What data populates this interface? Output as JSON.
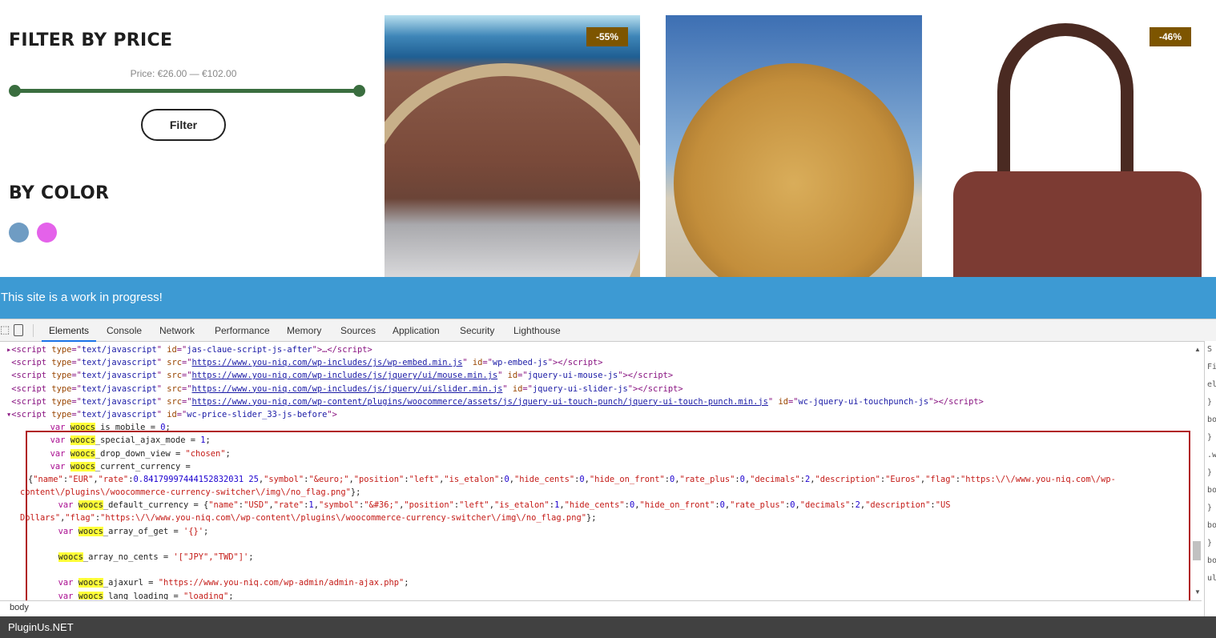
{
  "sidebar": {
    "filter_title": "FILTER BY PRICE",
    "price_label": "Price: €26.00 — €102.00",
    "price_min": 26,
    "price_max": 102,
    "filter_button": "Filter",
    "color_title": "BY COLOR",
    "swatches": [
      "#6f9cc3",
      "#e462ea"
    ]
  },
  "products": [
    {
      "badge": "-55%"
    },
    {
      "badge": ""
    },
    {
      "badge": "-46%"
    }
  ],
  "banner": "This site is a work in progress!",
  "devtools": {
    "tabs": [
      "Elements",
      "Console",
      "Network",
      "Performance",
      "Memory",
      "Sources",
      "Application",
      "Security",
      "Lighthouse"
    ],
    "active_tab": "Elements",
    "code_lines": [
      [
        [
          "tg",
          "▸<script "
        ],
        [
          "an",
          "type"
        ],
        [
          "tg",
          "=\""
        ],
        [
          "av",
          "text/javascript"
        ],
        [
          "tg",
          "\" "
        ],
        [
          "an",
          "id"
        ],
        [
          "tg",
          "=\""
        ],
        [
          "av",
          "jas-claue-script-js-after"
        ],
        [
          "tg",
          "\">…</script>"
        ]
      ],
      [
        [
          "tg",
          " <script "
        ],
        [
          "an",
          "type"
        ],
        [
          "tg",
          "=\""
        ],
        [
          "av",
          "text/javascript"
        ],
        [
          "tg",
          "\" "
        ],
        [
          "an",
          "src"
        ],
        [
          "tg",
          "=\""
        ],
        [
          "lk",
          "https://www.you-niq.com/wp-includes/js/wp-embed.min.js"
        ],
        [
          "tg",
          "\" "
        ],
        [
          "an",
          "id"
        ],
        [
          "tg",
          "=\""
        ],
        [
          "av",
          "wp-embed-js"
        ],
        [
          "tg",
          "\"></script>"
        ]
      ],
      [
        [
          "tg",
          " <script "
        ],
        [
          "an",
          "type"
        ],
        [
          "tg",
          "=\""
        ],
        [
          "av",
          "text/javascript"
        ],
        [
          "tg",
          "\" "
        ],
        [
          "an",
          "src"
        ],
        [
          "tg",
          "=\""
        ],
        [
          "lk",
          "https://www.you-niq.com/wp-includes/js/jquery/ui/mouse.min.js"
        ],
        [
          "tg",
          "\" "
        ],
        [
          "an",
          "id"
        ],
        [
          "tg",
          "=\""
        ],
        [
          "av",
          "jquery-ui-mouse-js"
        ],
        [
          "tg",
          "\"></script>"
        ]
      ],
      [
        [
          "tg",
          " <script "
        ],
        [
          "an",
          "type"
        ],
        [
          "tg",
          "=\""
        ],
        [
          "av",
          "text/javascript"
        ],
        [
          "tg",
          "\" "
        ],
        [
          "an",
          "src"
        ],
        [
          "tg",
          "=\""
        ],
        [
          "lk",
          "https://www.you-niq.com/wp-includes/js/jquery/ui/slider.min.js"
        ],
        [
          "tg",
          "\" "
        ],
        [
          "an",
          "id"
        ],
        [
          "tg",
          "=\""
        ],
        [
          "av",
          "jquery-ui-slider-js"
        ],
        [
          "tg",
          "\"></script>"
        ]
      ],
      [
        [
          "tg",
          " <script "
        ],
        [
          "an",
          "type"
        ],
        [
          "tg",
          "=\""
        ],
        [
          "av",
          "text/javascript"
        ],
        [
          "tg",
          "\" "
        ],
        [
          "an",
          "src"
        ],
        [
          "tg",
          "=\""
        ],
        [
          "lk",
          "https://www.you-niq.com/wp-content/plugins/woocommerce/assets/js/jquery-ui-touch-punch/jquery-ui-touch-punch.min.js"
        ],
        [
          "tg",
          "\" "
        ],
        [
          "an",
          "id"
        ],
        [
          "tg",
          "=\""
        ],
        [
          "av",
          "wc-jquery-ui-touchpunch-js"
        ],
        [
          "tg",
          "\"></script>"
        ]
      ],
      [
        [
          "tg",
          "▾<script "
        ],
        [
          "an",
          "type"
        ],
        [
          "tg",
          "=\""
        ],
        [
          "av",
          "text/javascript"
        ],
        [
          "tg",
          "\" "
        ],
        [
          "an",
          "id"
        ],
        [
          "tg",
          "=\""
        ],
        [
          "av",
          "wc-price-slider_33-js-before"
        ],
        [
          "tg",
          "\">"
        ]
      ],
      [
        [
          "",
          "          "
        ],
        [
          "kw",
          "var "
        ],
        [
          "hl",
          "woocs"
        ],
        [
          "",
          "_is_mobile = "
        ],
        [
          "nm",
          "0"
        ],
        [
          "",
          ";"
        ]
      ],
      [
        [
          "",
          "          "
        ],
        [
          "kw",
          "var "
        ],
        [
          "hl",
          "woocs"
        ],
        [
          "",
          "_special_ajax_mode = "
        ],
        [
          "nm",
          "1"
        ],
        [
          "",
          ";"
        ]
      ],
      [
        [
          "",
          "          "
        ],
        [
          "kw",
          "var "
        ],
        [
          "hl",
          "woocs"
        ],
        [
          "",
          "_drop_down_view = "
        ],
        [
          "st",
          "\"chosen\""
        ],
        [
          "",
          ";"
        ]
      ],
      [
        [
          "",
          "          "
        ],
        [
          "kw",
          "var "
        ],
        [
          "hl",
          "woocs"
        ],
        [
          "",
          "_current_currency ="
        ]
      ],
      [
        [
          "",
          "    {"
        ],
        [
          "st",
          "\"name\""
        ],
        [
          "",
          ":"
        ],
        [
          "st",
          "\"EUR\""
        ],
        [
          "",
          ","
        ],
        [
          "st",
          "\"rate\""
        ],
        [
          "",
          ":"
        ],
        [
          "nm",
          "0.84179997444152832031 25"
        ],
        [
          "",
          ","
        ],
        [
          "st",
          "\"symbol\""
        ],
        [
          "",
          ":"
        ],
        [
          "st",
          "\"&euro;\""
        ],
        [
          "",
          ","
        ],
        [
          "st",
          "\"position\""
        ],
        [
          "",
          ":"
        ],
        [
          "st",
          "\"left\""
        ],
        [
          "",
          ","
        ],
        [
          "st",
          "\"is_etalon\""
        ],
        [
          "",
          ":"
        ],
        [
          "nm",
          "0"
        ],
        [
          "",
          ","
        ],
        [
          "st",
          "\"hide_cents\""
        ],
        [
          "",
          ":"
        ],
        [
          "nm",
          "0"
        ],
        [
          "",
          ","
        ],
        [
          "st",
          "\"hide_on_front\""
        ],
        [
          "",
          ":"
        ],
        [
          "nm",
          "0"
        ],
        [
          "",
          ","
        ],
        [
          "st",
          "\"rate_plus\""
        ],
        [
          "",
          ":"
        ],
        [
          "nm",
          "0"
        ],
        [
          "",
          ","
        ],
        [
          "st",
          "\"decimals\""
        ],
        [
          "",
          ":"
        ],
        [
          "nm",
          "2"
        ],
        [
          "",
          ","
        ],
        [
          "st",
          "\"description\""
        ],
        [
          "",
          ":"
        ],
        [
          "st",
          "\"Euros\""
        ],
        [
          "",
          ","
        ],
        [
          "st",
          "\"flag\""
        ],
        [
          "",
          ":"
        ],
        [
          "st",
          "\"https:\\/\\/www.you-niq.com\\/wp-"
        ]
      ],
      [
        [
          "st",
          "    content\\/plugins\\/woocommerce-currency-switcher\\/img\\/no_flag.png\""
        ],
        [
          "",
          "};"
        ]
      ],
      [
        [
          "",
          "          "
        ],
        [
          "kw",
          "var "
        ],
        [
          "hl",
          "woocs"
        ],
        [
          "",
          "_default_currency = {"
        ],
        [
          "st",
          "\"name\""
        ],
        [
          "",
          ":"
        ],
        [
          "st",
          "\"USD\""
        ],
        [
          "",
          ","
        ],
        [
          "st",
          "\"rate\""
        ],
        [
          "",
          ":"
        ],
        [
          "nm",
          "1"
        ],
        [
          "",
          ","
        ],
        [
          "st",
          "\"symbol\""
        ],
        [
          "",
          ":"
        ],
        [
          "st",
          "\"&#36;\""
        ],
        [
          "",
          ","
        ],
        [
          "st",
          "\"position\""
        ],
        [
          "",
          ":"
        ],
        [
          "st",
          "\"left\""
        ],
        [
          "",
          ","
        ],
        [
          "st",
          "\"is_etalon\""
        ],
        [
          "",
          ":"
        ],
        [
          "nm",
          "1"
        ],
        [
          "",
          ","
        ],
        [
          "st",
          "\"hide_cents\""
        ],
        [
          "",
          ":"
        ],
        [
          "nm",
          "0"
        ],
        [
          "",
          ","
        ],
        [
          "st",
          "\"hide_on_front\""
        ],
        [
          "",
          ":"
        ],
        [
          "nm",
          "0"
        ],
        [
          "",
          ","
        ],
        [
          "st",
          "\"rate_plus\""
        ],
        [
          "",
          ":"
        ],
        [
          "nm",
          "0"
        ],
        [
          "",
          ","
        ],
        [
          "st",
          "\"decimals\""
        ],
        [
          "",
          ":"
        ],
        [
          "nm",
          "2"
        ],
        [
          "",
          ","
        ],
        [
          "st",
          "\"description\""
        ],
        [
          "",
          ":"
        ],
        [
          "st",
          "\"US"
        ]
      ],
      [
        [
          "st",
          "    Dollars\""
        ],
        [
          "",
          ","
        ],
        [
          "st",
          "\"flag\""
        ],
        [
          "",
          ":"
        ],
        [
          "st",
          "\"https:\\/\\/www.you-niq.com\\/wp-content\\/plugins\\/woocommerce-currency-switcher\\/img\\/no_flag.png\""
        ],
        [
          "",
          "};"
        ]
      ],
      [
        [
          "",
          "          "
        ],
        [
          "kw",
          "var "
        ],
        [
          "hl",
          "woocs"
        ],
        [
          "",
          "_array_of_get = "
        ],
        [
          "st",
          "'{}'"
        ],
        [
          "",
          ";"
        ]
      ],
      [
        [
          "",
          ""
        ]
      ],
      [
        [
          "",
          "          "
        ],
        [
          "hl",
          "woocs"
        ],
        [
          "",
          "_array_no_cents = "
        ],
        [
          "st",
          "'[\"JPY\",\"TWD\"]'"
        ],
        [
          "",
          ";"
        ]
      ],
      [
        [
          "",
          ""
        ]
      ],
      [
        [
          "",
          "          "
        ],
        [
          "kw",
          "var "
        ],
        [
          "hl",
          "woocs"
        ],
        [
          "",
          "_ajaxurl = "
        ],
        [
          "st",
          "\"https://www.you-niq.com/wp-admin/admin-ajax.php\""
        ],
        [
          "",
          ";"
        ]
      ],
      [
        [
          "",
          "          "
        ],
        [
          "kw",
          "var "
        ],
        [
          "hl",
          "woocs"
        ],
        [
          "",
          "_lang_loading = "
        ],
        [
          "st",
          "\"loading\""
        ],
        [
          "",
          ";"
        ]
      ]
    ],
    "breadcrumb": "body",
    "styles_pane": [
      "S",
      "Fi",
      "el",
      "}",
      "bo",
      "}",
      ".w",
      "}",
      "bo",
      "}",
      "bo",
      "}",
      "bo",
      "ul"
    ]
  },
  "footer": "PluginUs.NET"
}
